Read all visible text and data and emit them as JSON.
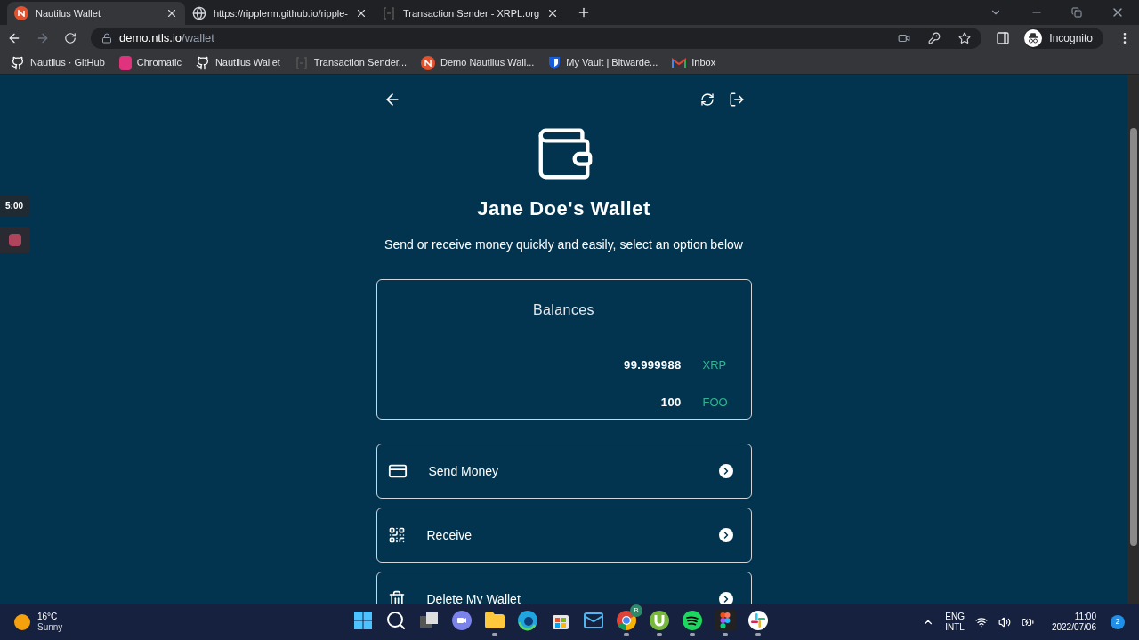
{
  "tabs": [
    {
      "title": "Nautilus Wallet",
      "kind": "nautilus",
      "selected": true
    },
    {
      "title": "https://ripplerm.github.io/ripple-",
      "kind": "globe",
      "selected": false
    },
    {
      "title": "Transaction Sender - XRPL.org",
      "kind": "xrpl",
      "selected": false
    }
  ],
  "address": {
    "host": "demo.ntls.io",
    "path": "/wallet"
  },
  "profile": "Incognito",
  "bookmarks": [
    {
      "label": "Nautilus · GitHub",
      "kind": "github"
    },
    {
      "label": "Chromatic",
      "kind": "chromatic"
    },
    {
      "label": "Nautilus Wallet",
      "kind": "github"
    },
    {
      "label": "Transaction Sender...",
      "kind": "xrpl"
    },
    {
      "label": "Demo Nautilus Wall...",
      "kind": "nautilus"
    },
    {
      "label": "My Vault | Bitwarde...",
      "kind": "bitwarden"
    },
    {
      "label": "Inbox",
      "kind": "gmail"
    }
  ],
  "timer": "5:00",
  "title": "Jane Doe's Wallet",
  "subtitle": "Send or receive money quickly and easily, select an option below",
  "balances_title": "Balances",
  "balances": [
    {
      "amount": "99.999988",
      "currency": "XRP"
    },
    {
      "amount": "100",
      "currency": "FOO"
    }
  ],
  "actions": [
    {
      "label": "Send Money",
      "kind": "card"
    },
    {
      "label": "Receive",
      "kind": "qr"
    },
    {
      "label": "Delete My Wallet",
      "kind": "trash"
    }
  ],
  "taskbar": {
    "temperature": "16°C",
    "weather": "Sunny",
    "apps": [
      {
        "kind": "windows",
        "running": false
      },
      {
        "kind": "search",
        "running": false
      },
      {
        "kind": "taskview",
        "running": false
      },
      {
        "kind": "chat",
        "running": false
      },
      {
        "kind": "folder",
        "running": true
      },
      {
        "kind": "edge",
        "running": false
      },
      {
        "kind": "store",
        "running": false
      },
      {
        "kind": "mail",
        "running": false
      },
      {
        "kind": "chrome",
        "running": true,
        "badge": "B"
      },
      {
        "kind": "torrent",
        "running": true
      },
      {
        "kind": "spotify",
        "running": true
      },
      {
        "kind": "figma",
        "running": true
      },
      {
        "kind": "slack",
        "running": true
      }
    ],
    "language": "ENG",
    "layout": "INTL",
    "time": "11:00",
    "date": "2022/07/06",
    "notifications": "2"
  }
}
